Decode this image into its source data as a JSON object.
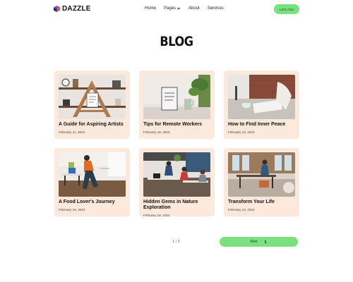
{
  "brand": {
    "name": "DAZZLE"
  },
  "nav": {
    "items": [
      {
        "label": "Home",
        "dropdown": false
      },
      {
        "label": "Pages",
        "dropdown": true
      },
      {
        "label": "About",
        "dropdown": false
      },
      {
        "label": "Services",
        "dropdown": false
      }
    ],
    "cta_label": "Let's chat"
  },
  "page": {
    "title": "BLOG"
  },
  "posts": [
    {
      "title": "A Guide for Aspiring Artists",
      "date": "February 11, 2024",
      "image": "artist-shelf"
    },
    {
      "title": "Tips for Remote Workers",
      "date": "February 18, 2024",
      "image": "desk-frame-plant"
    },
    {
      "title": "How to Find Inner Peace",
      "date": "February 13, 2024",
      "image": "writing-notebook"
    },
    {
      "title": "A Food Lover's Journey",
      "date": "February 15, 2024",
      "image": "office-stretch"
    },
    {
      "title": "Hidden Gems in Nature Exploration",
      "date": "February 18, 2024",
      "image": "open-office-team"
    },
    {
      "title": "Transform Your Life",
      "date": "February 13, 2024",
      "image": "coworking-space"
    }
  ],
  "pagination": {
    "label": "1 / 2",
    "next_label": "Next",
    "next_icon": "arrow-right-icon"
  },
  "colors": {
    "accent": "#7be07f",
    "card_bg": "#fde8dc",
    "text": "#111111"
  }
}
